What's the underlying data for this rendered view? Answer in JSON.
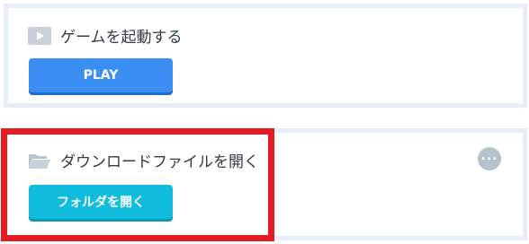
{
  "launch_card": {
    "title": "ゲームを起動する",
    "icon": "play-icon",
    "button_label": "PLAY"
  },
  "download_card": {
    "title": "ダウンロードファイルを開く",
    "icon": "folder-icon",
    "button_label": "フォルダを開く",
    "more_icon": "more-options-icon"
  },
  "colors": {
    "play_button": "#3b8ff2",
    "folder_button": "#10bddd",
    "highlight": "#e31b23",
    "card_border": "#e8eef8"
  }
}
